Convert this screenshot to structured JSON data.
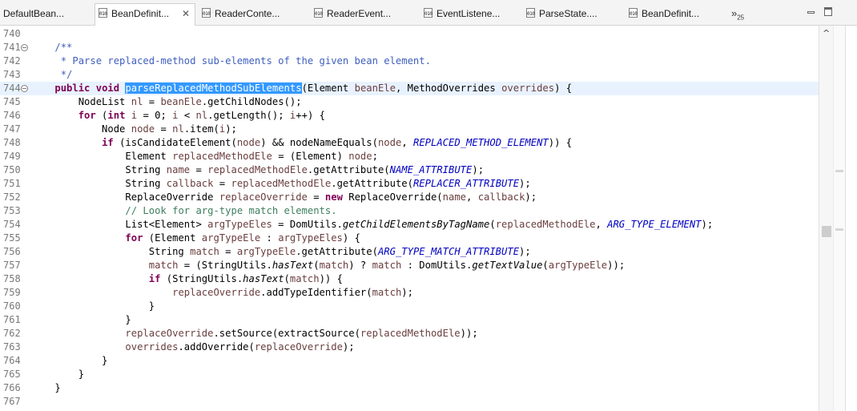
{
  "tabs": [
    {
      "label": "DefaultBean...",
      "active": false,
      "icon": "class-file-icon"
    },
    {
      "label": "BeanDefinit...",
      "active": true,
      "icon": "class-file-icon",
      "close": "✕"
    },
    {
      "label": "ReaderConte...",
      "active": false,
      "icon": "class-file-icon"
    },
    {
      "label": "ReaderEvent...",
      "active": false,
      "icon": "class-file-icon"
    },
    {
      "label": "EventListene...",
      "active": false,
      "icon": "class-file-icon"
    },
    {
      "label": "ParseState....",
      "active": false,
      "icon": "class-file-icon"
    },
    {
      "label": "BeanDefinit...",
      "active": false,
      "icon": "class-file-icon"
    }
  ],
  "tab_icon_bits": "010",
  "overflow": {
    "chevron": "»",
    "count": "25"
  },
  "window_controls": {
    "minimize": "minimize-icon",
    "maximize": "maximize-icon"
  },
  "editor": {
    "current_line": "744",
    "selected_text": "parseReplacedMethodSubElements",
    "lines": [
      {
        "n": "740",
        "fold": false,
        "segs": [
          {
            "t": ""
          }
        ]
      },
      {
        "n": "741",
        "fold": true,
        "segs": [
          {
            "t": "    "
          },
          {
            "t": "/**",
            "c": "jd"
          }
        ]
      },
      {
        "n": "742",
        "fold": false,
        "segs": [
          {
            "t": "     "
          },
          {
            "t": "* Parse replaced-method sub-elements of the given bean element.",
            "c": "jd"
          }
        ]
      },
      {
        "n": "743",
        "fold": false,
        "segs": [
          {
            "t": "     "
          },
          {
            "t": "*/",
            "c": "jd"
          }
        ]
      },
      {
        "n": "744",
        "fold": true,
        "hl": true,
        "segs": [
          {
            "t": "    "
          },
          {
            "t": "public",
            "c": "kw"
          },
          {
            "t": " "
          },
          {
            "t": "void",
            "c": "kw"
          },
          {
            "t": " "
          },
          {
            "t": "parseReplacedMethodSubElements",
            "c": "sel"
          },
          {
            "t": "(Element "
          },
          {
            "t": "beanEle",
            "c": "var"
          },
          {
            "t": ", MethodOverrides "
          },
          {
            "t": "overrides",
            "c": "var"
          },
          {
            "t": ") {"
          }
        ]
      },
      {
        "n": "745",
        "fold": false,
        "segs": [
          {
            "t": "        NodeList "
          },
          {
            "t": "nl",
            "c": "var"
          },
          {
            "t": " = "
          },
          {
            "t": "beanEle",
            "c": "var"
          },
          {
            "t": ".getChildNodes();"
          }
        ]
      },
      {
        "n": "746",
        "fold": false,
        "segs": [
          {
            "t": "        "
          },
          {
            "t": "for",
            "c": "kw"
          },
          {
            "t": " ("
          },
          {
            "t": "int",
            "c": "kw"
          },
          {
            "t": " "
          },
          {
            "t": "i",
            "c": "var"
          },
          {
            "t": " = 0; "
          },
          {
            "t": "i",
            "c": "var"
          },
          {
            "t": " < "
          },
          {
            "t": "nl",
            "c": "var"
          },
          {
            "t": ".getLength(); "
          },
          {
            "t": "i",
            "c": "var"
          },
          {
            "t": "++) {"
          }
        ]
      },
      {
        "n": "747",
        "fold": false,
        "segs": [
          {
            "t": "            Node "
          },
          {
            "t": "node",
            "c": "var"
          },
          {
            "t": " = "
          },
          {
            "t": "nl",
            "c": "var"
          },
          {
            "t": ".item("
          },
          {
            "t": "i",
            "c": "var"
          },
          {
            "t": ");"
          }
        ]
      },
      {
        "n": "748",
        "fold": false,
        "segs": [
          {
            "t": "            "
          },
          {
            "t": "if",
            "c": "kw"
          },
          {
            "t": " (isCandidateElement("
          },
          {
            "t": "node",
            "c": "var"
          },
          {
            "t": ") && nodeNameEquals("
          },
          {
            "t": "node",
            "c": "var"
          },
          {
            "t": ", "
          },
          {
            "t": "REPLACED_METHOD_ELEMENT",
            "c": "fld"
          },
          {
            "t": ")) {"
          }
        ]
      },
      {
        "n": "749",
        "fold": false,
        "segs": [
          {
            "t": "                Element "
          },
          {
            "t": "replacedMethodEle",
            "c": "var"
          },
          {
            "t": " = (Element) "
          },
          {
            "t": "node",
            "c": "var"
          },
          {
            "t": ";"
          }
        ]
      },
      {
        "n": "750",
        "fold": false,
        "segs": [
          {
            "t": "                String "
          },
          {
            "t": "name",
            "c": "var"
          },
          {
            "t": " = "
          },
          {
            "t": "replacedMethodEle",
            "c": "var"
          },
          {
            "t": ".getAttribute("
          },
          {
            "t": "NAME_ATTRIBUTE",
            "c": "fld"
          },
          {
            "t": ");"
          }
        ]
      },
      {
        "n": "751",
        "fold": false,
        "segs": [
          {
            "t": "                String "
          },
          {
            "t": "callback",
            "c": "var"
          },
          {
            "t": " = "
          },
          {
            "t": "replacedMethodEle",
            "c": "var"
          },
          {
            "t": ".getAttribute("
          },
          {
            "t": "REPLACER_ATTRIBUTE",
            "c": "fld"
          },
          {
            "t": ");"
          }
        ]
      },
      {
        "n": "752",
        "fold": false,
        "segs": [
          {
            "t": "                ReplaceOverride "
          },
          {
            "t": "replaceOverride",
            "c": "var"
          },
          {
            "t": " = "
          },
          {
            "t": "new",
            "c": "kw"
          },
          {
            "t": " ReplaceOverride("
          },
          {
            "t": "name",
            "c": "var"
          },
          {
            "t": ", "
          },
          {
            "t": "callback",
            "c": "var"
          },
          {
            "t": ");"
          }
        ]
      },
      {
        "n": "753",
        "fold": false,
        "segs": [
          {
            "t": "                "
          },
          {
            "t": "// Look for arg-type match elements.",
            "c": "cm"
          }
        ]
      },
      {
        "n": "754",
        "fold": false,
        "segs": [
          {
            "t": "                List<Element> "
          },
          {
            "t": "argTypeEles",
            "c": "var"
          },
          {
            "t": " = DomUtils."
          },
          {
            "t": "getChildElementsByTagName",
            "c": "st"
          },
          {
            "t": "("
          },
          {
            "t": "replacedMethodEle",
            "c": "var"
          },
          {
            "t": ", "
          },
          {
            "t": "ARG_TYPE_ELEMENT",
            "c": "fld"
          },
          {
            "t": ");"
          }
        ]
      },
      {
        "n": "755",
        "fold": false,
        "segs": [
          {
            "t": "                "
          },
          {
            "t": "for",
            "c": "kw"
          },
          {
            "t": " (Element "
          },
          {
            "t": "argTypeEle",
            "c": "var"
          },
          {
            "t": " : "
          },
          {
            "t": "argTypeEles",
            "c": "var"
          },
          {
            "t": ") {"
          }
        ]
      },
      {
        "n": "756",
        "fold": false,
        "segs": [
          {
            "t": "                    String "
          },
          {
            "t": "match",
            "c": "var"
          },
          {
            "t": " = "
          },
          {
            "t": "argTypeEle",
            "c": "var"
          },
          {
            "t": ".getAttribute("
          },
          {
            "t": "ARG_TYPE_MATCH_ATTRIBUTE",
            "c": "fld"
          },
          {
            "t": ");"
          }
        ]
      },
      {
        "n": "757",
        "fold": false,
        "segs": [
          {
            "t": "                    "
          },
          {
            "t": "match",
            "c": "var"
          },
          {
            "t": " = (StringUtils."
          },
          {
            "t": "hasText",
            "c": "st"
          },
          {
            "t": "("
          },
          {
            "t": "match",
            "c": "var"
          },
          {
            "t": ") ? "
          },
          {
            "t": "match",
            "c": "var"
          },
          {
            "t": " : DomUtils."
          },
          {
            "t": "getTextValue",
            "c": "st"
          },
          {
            "t": "("
          },
          {
            "t": "argTypeEle",
            "c": "var"
          },
          {
            "t": "));"
          }
        ]
      },
      {
        "n": "758",
        "fold": false,
        "segs": [
          {
            "t": "                    "
          },
          {
            "t": "if",
            "c": "kw"
          },
          {
            "t": " (StringUtils."
          },
          {
            "t": "hasText",
            "c": "st"
          },
          {
            "t": "("
          },
          {
            "t": "match",
            "c": "var"
          },
          {
            "t": ")) {"
          }
        ]
      },
      {
        "n": "759",
        "fold": false,
        "segs": [
          {
            "t": "                        "
          },
          {
            "t": "replaceOverride",
            "c": "var"
          },
          {
            "t": ".addTypeIdentifier("
          },
          {
            "t": "match",
            "c": "var"
          },
          {
            "t": ");"
          }
        ]
      },
      {
        "n": "760",
        "fold": false,
        "segs": [
          {
            "t": "                    }"
          }
        ]
      },
      {
        "n": "761",
        "fold": false,
        "segs": [
          {
            "t": "                }"
          }
        ]
      },
      {
        "n": "762",
        "fold": false,
        "segs": [
          {
            "t": "                "
          },
          {
            "t": "replaceOverride",
            "c": "var"
          },
          {
            "t": ".setSource(extractSource("
          },
          {
            "t": "replacedMethodEle",
            "c": "var"
          },
          {
            "t": "));"
          }
        ]
      },
      {
        "n": "763",
        "fold": false,
        "segs": [
          {
            "t": "                "
          },
          {
            "t": "overrides",
            "c": "var"
          },
          {
            "t": ".addOverride("
          },
          {
            "t": "replaceOverride",
            "c": "var"
          },
          {
            "t": ");"
          }
        ]
      },
      {
        "n": "764",
        "fold": false,
        "segs": [
          {
            "t": "            }"
          }
        ]
      },
      {
        "n": "765",
        "fold": false,
        "segs": [
          {
            "t": "        }"
          }
        ]
      },
      {
        "n": "766",
        "fold": false,
        "segs": [
          {
            "t": "    }"
          }
        ]
      },
      {
        "n": "767",
        "fold": false,
        "segs": [
          {
            "t": ""
          }
        ]
      }
    ]
  },
  "scrollbar": {
    "up_arrow": "^"
  }
}
